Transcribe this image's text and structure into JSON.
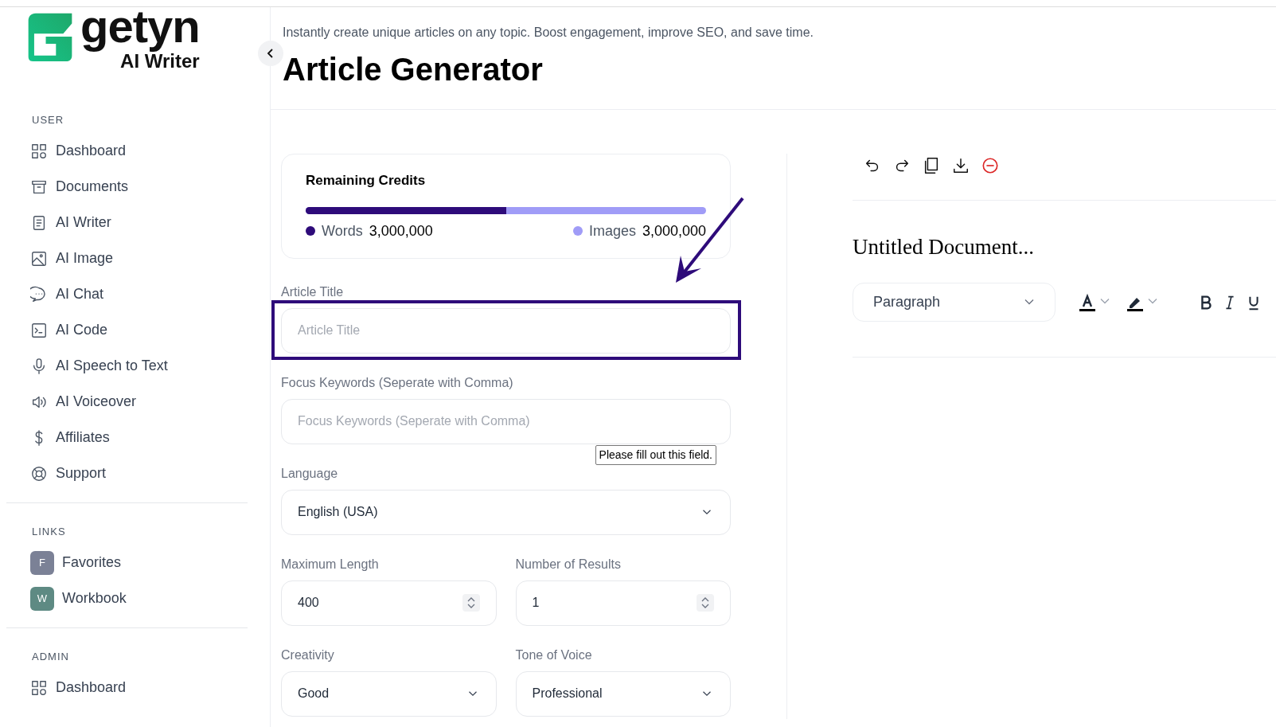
{
  "sidebar": {
    "logo": {
      "name": "getyn",
      "tagline": "AI Writer"
    },
    "sections": [
      {
        "heading": "USER",
        "items": [
          {
            "label": "Dashboard"
          },
          {
            "label": "Documents"
          },
          {
            "label": "AI Writer"
          },
          {
            "label": "AI Image"
          },
          {
            "label": "AI Chat"
          },
          {
            "label": "AI Code"
          },
          {
            "label": "AI Speech to Text"
          },
          {
            "label": "AI Voiceover"
          },
          {
            "label": "Affiliates"
          },
          {
            "label": "Support"
          }
        ]
      },
      {
        "heading": "LINKS",
        "items": [
          {
            "label": "Favorites",
            "avatar": "F",
            "color": "#7b8196"
          },
          {
            "label": "Workbook",
            "avatar": "W",
            "color": "#5e8a83"
          }
        ]
      },
      {
        "heading": "ADMIN",
        "items": [
          {
            "label": "Dashboard"
          }
        ]
      }
    ]
  },
  "header": {
    "subtitle": "Instantly create unique articles on any topic. Boost engagement, improve SEO, and save time.",
    "title": "Article Generator"
  },
  "credits": {
    "title": "Remaining Credits",
    "level": 0.5,
    "legend": [
      {
        "label": "Words",
        "value": "3,000,000",
        "color": "#2e0b7a"
      },
      {
        "label": "Images",
        "value": "3,000,000",
        "color": "#a09cf7"
      }
    ]
  },
  "form_rows": [
    [
      {
        "kind": "text",
        "label": "Article Title",
        "placeholder": "Article Title",
        "highlighted": true
      }
    ],
    [
      {
        "kind": "text",
        "label": "Focus Keywords (Seperate with Comma)",
        "placeholder": "Focus Keywords (Seperate with Comma)",
        "highlighted": false,
        "tooltip": "Please fill out this field."
      }
    ],
    [
      {
        "kind": "select",
        "label": "Language",
        "value": "English (USA)"
      }
    ],
    [
      {
        "kind": "number",
        "label": "Maximum Length",
        "value": "400"
      },
      {
        "kind": "number",
        "label": "Number of Results",
        "value": "1"
      }
    ],
    [
      {
        "kind": "select",
        "label": "Creativity",
        "value": "Good"
      },
      {
        "kind": "select",
        "label": "Tone of Voice",
        "value": "Professional"
      }
    ]
  ],
  "editor": {
    "title": "Untitled Document...",
    "block_format": "Paragraph"
  }
}
